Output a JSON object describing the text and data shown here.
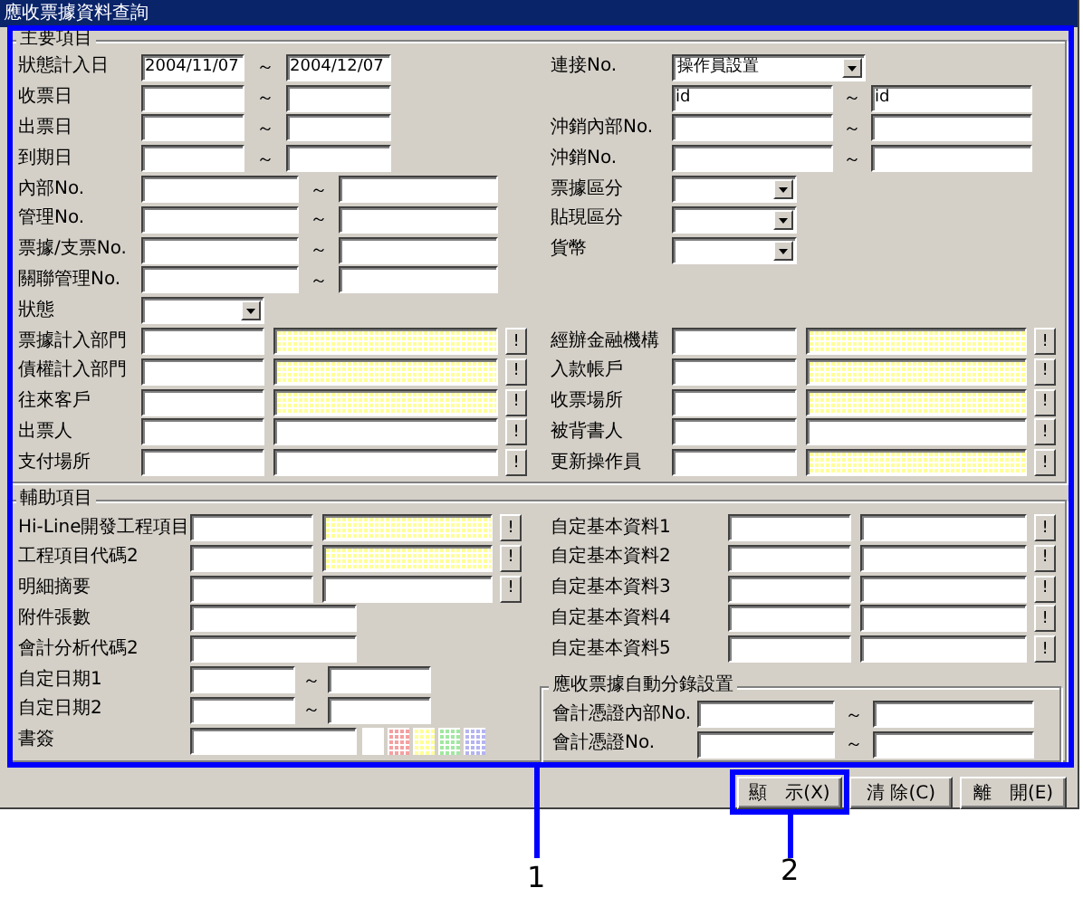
{
  "window": {
    "title": "應收票據資料查詢"
  },
  "main_group": {
    "title": "主要項目",
    "left": [
      {
        "kind": "date_range",
        "label": "狀態計入日",
        "from": "2004/11/07",
        "separator": "～",
        "to": "2004/12/07"
      },
      {
        "kind": "date_range",
        "label": "收票日",
        "separator": "～"
      },
      {
        "kind": "date_range",
        "label": "出票日",
        "separator": "～"
      },
      {
        "kind": "date_range",
        "label": "到期日",
        "separator": "～"
      },
      {
        "kind": "text_range",
        "label": "內部No.",
        "separator": "～"
      },
      {
        "kind": "text_range",
        "label": "管理No.",
        "separator": "～"
      },
      {
        "kind": "text_range",
        "label": "票據/支票No.",
        "separator": "～"
      },
      {
        "kind": "text_range",
        "label": "關聯管理No.",
        "separator": "～"
      },
      {
        "kind": "select",
        "label": "狀態"
      }
    ],
    "right": [
      {
        "kind": "wide_select",
        "label": "連接No.",
        "value": "操作員設置"
      },
      {
        "kind": "text_range",
        "from": "id",
        "separator": "～",
        "to": "id"
      },
      {
        "kind": "text_range",
        "label": "沖銷內部No.",
        "separator": "～"
      },
      {
        "kind": "text_range",
        "label": "沖銷No.",
        "separator": "～"
      },
      {
        "kind": "select",
        "label": "票據區分"
      },
      {
        "kind": "select",
        "label": "貼現區分"
      },
      {
        "kind": "select",
        "label": "貨幣"
      }
    ],
    "left_lookups": [
      {
        "kind": "lookup",
        "label": "票據計入部門",
        "highlighted": true,
        "button": "!"
      },
      {
        "kind": "lookup",
        "label": "債權計入部門",
        "highlighted": true,
        "button": "!"
      },
      {
        "kind": "lookup",
        "label": "往來客戶",
        "highlighted": true,
        "button": "!"
      },
      {
        "kind": "lookup",
        "label": "出票人",
        "highlighted": false,
        "button": "!"
      },
      {
        "kind": "lookup",
        "label": "支付場所",
        "highlighted": false,
        "button": "!"
      }
    ],
    "right_lookups": [
      {
        "kind": "lookup",
        "label": "經辦金融機構",
        "highlighted": true,
        "button": "!"
      },
      {
        "kind": "lookup",
        "label": "入款帳戶",
        "highlighted": true,
        "button": "!"
      },
      {
        "kind": "lookup",
        "label": "收票場所",
        "highlighted": true,
        "button": "!"
      },
      {
        "kind": "lookup",
        "label": "被背書人",
        "highlighted": false,
        "button": "!"
      },
      {
        "kind": "lookup",
        "label": "更新操作員",
        "highlighted": true,
        "button": "!"
      }
    ]
  },
  "aux_group": {
    "title": "輔助項目",
    "left": [
      {
        "kind": "lookup",
        "label": "Hi-Line開發工程項目",
        "highlighted": true,
        "button": "!"
      },
      {
        "kind": "lookup",
        "label": "工程項目代碼2",
        "highlighted": true,
        "button": "!"
      },
      {
        "kind": "lookup",
        "label": "明細摘要",
        "highlighted": false,
        "button": "!"
      },
      {
        "kind": "text",
        "label": "附件張數"
      },
      {
        "kind": "text",
        "label": "會計分析代碼2"
      },
      {
        "kind": "date_range",
        "label": "自定日期1",
        "separator": "～"
      },
      {
        "kind": "date_range",
        "label": "自定日期2",
        "separator": "～"
      },
      {
        "kind": "bookmark",
        "label": "書簽",
        "swatches": [
          {
            "color": "#ffffff"
          },
          {
            "color": "#f4a0a0"
          },
          {
            "color": "#ffff99"
          },
          {
            "color": "#a0e8a0"
          },
          {
            "color": "#b4b4f0"
          }
        ]
      }
    ],
    "right": [
      {
        "kind": "lookup",
        "label": "自定基本資料1",
        "highlighted": false,
        "button": "!"
      },
      {
        "kind": "lookup",
        "label": "自定基本資料2",
        "highlighted": false,
        "button": "!"
      },
      {
        "kind": "lookup",
        "label": "自定基本資料3",
        "highlighted": false,
        "button": "!"
      },
      {
        "kind": "lookup",
        "label": "自定基本資料4",
        "highlighted": false,
        "button": "!"
      },
      {
        "kind": "lookup",
        "label": "自定基本資料5",
        "highlighted": false,
        "button": "!"
      }
    ],
    "subgroup": {
      "title": "應收票據自動分錄設置",
      "rows": [
        {
          "kind": "text_range",
          "label": "會計憑證內部No.",
          "separator": "～"
        },
        {
          "kind": "text_range",
          "label": "會計憑證No.",
          "separator": "～"
        }
      ]
    }
  },
  "buttons": [
    {
      "label": "顯　示(X)",
      "highlighted": true
    },
    {
      "label": "清 除(C)",
      "highlighted": false
    },
    {
      "label": "離　開(E)",
      "highlighted": false
    }
  ],
  "callouts": [
    {
      "number": "1"
    },
    {
      "number": "2"
    }
  ]
}
